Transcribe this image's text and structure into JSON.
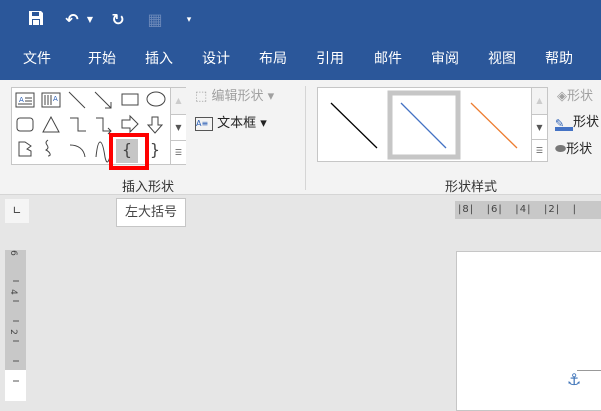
{
  "qat": {
    "save": "save-icon",
    "undo": "undo-icon",
    "redo": "redo-icon",
    "table": "table-draw-icon",
    "customize": "customize-icon"
  },
  "tabs": [
    "文件",
    "开始",
    "插入",
    "设计",
    "布局",
    "引用",
    "邮件",
    "审阅",
    "视图",
    "帮助"
  ],
  "insert_shapes": {
    "label": "插入形状",
    "edit_shape": "编辑形状",
    "text_box": "文本框",
    "shapes": [
      "text-box-horizontal",
      "text-box-vertical",
      "line",
      "arrow-line",
      "rectangle",
      "oval",
      "rounded-rectangle",
      "triangle",
      "elbow-connector",
      "elbow-arrow-connector",
      "right-arrow",
      "down-arrow",
      "freeform",
      "scribble",
      "arc",
      "curve",
      "left-brace",
      "right-brace"
    ],
    "selected": "left-brace"
  },
  "shape_styles": {
    "label": "形状样式",
    "fill": "形状",
    "outline": "形状",
    "effects": "形状",
    "styles": [
      {
        "color": "#000000"
      },
      {
        "color": "#4472c4"
      },
      {
        "color": "#ed7d31"
      }
    ],
    "selected_index": 1
  },
  "tooltip": "左大括号",
  "ruler_corner": "∟",
  "h_ruler": [
    "8",
    "6",
    "4",
    "2"
  ],
  "v_ruler": [
    "6",
    "4",
    "2"
  ],
  "highlight_color": "#ff0000"
}
